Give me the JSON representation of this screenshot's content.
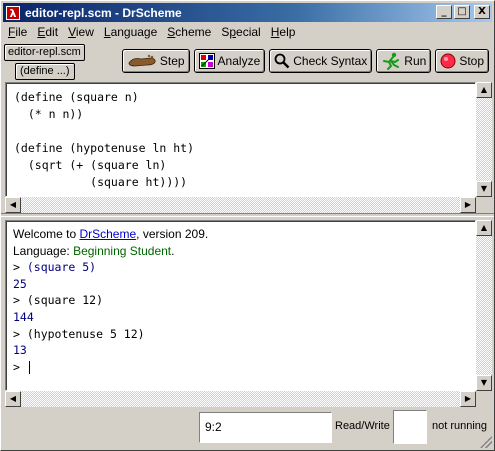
{
  "window": {
    "title": "editor-repl.scm - DrScheme",
    "icon": "lambda-icon",
    "controls": {
      "minimize": "_",
      "maximize": "□",
      "close": "X"
    }
  },
  "menubar": {
    "items": [
      {
        "label": "File",
        "accel": "F"
      },
      {
        "label": "Edit",
        "accel": "E"
      },
      {
        "label": "View",
        "accel": "V"
      },
      {
        "label": "Language",
        "accel": "L"
      },
      {
        "label": "Scheme",
        "accel": "S"
      },
      {
        "label": "Special",
        "accel": "p"
      },
      {
        "label": "Help",
        "accel": "H"
      }
    ]
  },
  "file_label": "editor-repl.scm",
  "define_menu": "(define ...)",
  "toolbar": {
    "step": {
      "label": "Step",
      "icon": "footprint-icon"
    },
    "analyze": {
      "label": "Analyze",
      "icon": "analyze-icon"
    },
    "check_syntax": {
      "label": "Check Syntax",
      "icon": "magnifier-icon"
    },
    "run": {
      "label": "Run",
      "icon": "runner-icon"
    },
    "stop": {
      "label": "Stop",
      "icon": "stop-icon"
    }
  },
  "definitions": {
    "code": "(define (square n)\n  (* n n))\n\n(define (hypotenuse ln ht)\n  (sqrt (+ (square ln)\n           (square ht))))"
  },
  "repl": {
    "welcome_prefix": "Welcome to ",
    "welcome_link": "DrScheme",
    "welcome_suffix": ", version 209.",
    "language_prefix": "Language: ",
    "language_name": "Beginning Student",
    "language_suffix": ".",
    "interactions": [
      {
        "prompt": "> ",
        "input": "(square 5)",
        "output": "25"
      },
      {
        "prompt": "> ",
        "input": "(square 12)",
        "output": "144"
      },
      {
        "prompt": "> ",
        "input": "(hypotenuse 5 12)",
        "output": "13"
      }
    ],
    "final_prompt": "> "
  },
  "status": {
    "position": "9:2",
    "mode": "Read/Write",
    "state": "not running"
  },
  "colors": {
    "titlebar_start": "#0a246a",
    "titlebar_end": "#a6caf0",
    "repl_output": "#000080",
    "language_name": "#006400",
    "link": "#0000cc"
  }
}
